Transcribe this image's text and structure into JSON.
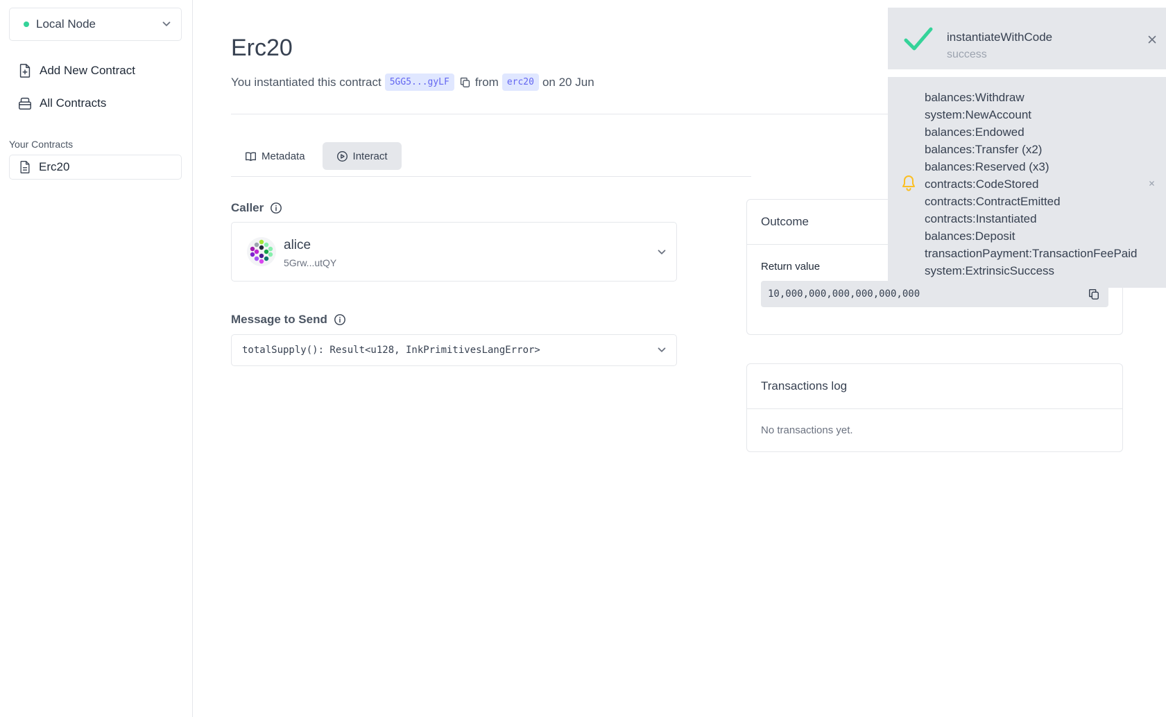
{
  "sidebar": {
    "node": {
      "label": "Local Node",
      "status_color": "#34d399"
    },
    "nav": [
      {
        "label": "Add New Contract",
        "icon": "file-plus-icon"
      },
      {
        "label": "All Contracts",
        "icon": "database-icon"
      }
    ],
    "section_label": "Your Contracts",
    "contracts": [
      {
        "label": "Erc20",
        "icon": "document-icon"
      }
    ]
  },
  "main": {
    "title": "Erc20",
    "subtitle": {
      "prefix": "You instantiated this contract",
      "address": "5GG5...gyLF",
      "from_word": "from",
      "code_name": "erc20",
      "date_text": "on 20 Jun"
    },
    "tabs": [
      {
        "label": "Metadata",
        "icon": "book-icon",
        "active": false
      },
      {
        "label": "Interact",
        "icon": "play-circle-icon",
        "active": true
      }
    ],
    "caller": {
      "label": "Caller",
      "name": "alice",
      "address": "5Grw...utQY"
    },
    "message": {
      "label": "Message to Send",
      "value": "totalSupply(): Result<u128, InkPrimitivesLangError>"
    }
  },
  "outcome": {
    "title": "Outcome",
    "return_label": "Return value",
    "return_value": "10,000,000,000,000,000,000"
  },
  "transactions": {
    "title": "Transactions log",
    "empty_text": "No transactions yet."
  },
  "toasts": {
    "success": {
      "title": "instantiateWithCode",
      "status": "success",
      "icon": "check-icon",
      "color": "#34d399"
    },
    "events": {
      "icon": "bell-icon",
      "color": "#fbbf24",
      "items": [
        "balances:Withdraw",
        "system:NewAccount",
        "balances:Endowed",
        "balances:Transfer (x2)",
        "balances:Reserved (x3)",
        "contracts:CodeStored",
        "contracts:ContractEmitted",
        "contracts:Instantiated",
        "balances:Deposit",
        "transactionPayment:TransactionFeePaid",
        "system:ExtrinsicSuccess"
      ]
    }
  }
}
